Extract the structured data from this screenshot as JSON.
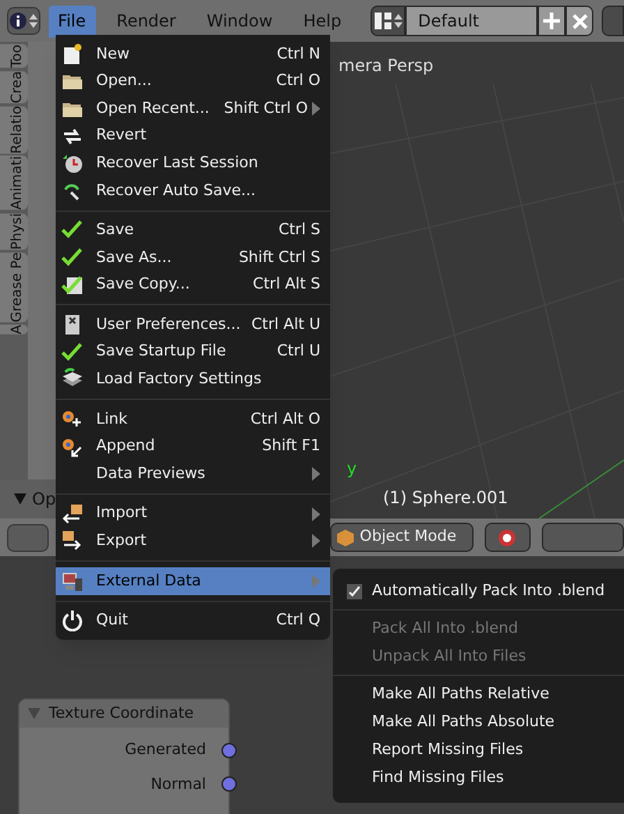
{
  "top_bar": {
    "menus": [
      {
        "label": "File",
        "selected": true
      },
      {
        "label": "Render",
        "selected": false
      },
      {
        "label": "Window",
        "selected": false
      },
      {
        "label": "Help",
        "selected": false
      }
    ],
    "layout": "Default"
  },
  "tool_tabs": [
    {
      "label": "Too"
    },
    {
      "label": "Crea"
    },
    {
      "label": "Relatio"
    },
    {
      "label": "Animati"
    },
    {
      "label": "Physi"
    },
    {
      "label": "Grease Pe"
    },
    {
      "label": "A"
    }
  ],
  "operator_panel": {
    "title": "Op"
  },
  "viewport": {
    "view_label": "mera Persp",
    "axis_label": "y",
    "object_label": "(1) Sphere.001"
  },
  "view_header": {
    "mode": "Object Mode"
  },
  "file_menu": {
    "groups": [
      [
        {
          "label": "New",
          "shortcut": "Ctrl N",
          "submenu": false,
          "selected": false
        },
        {
          "label": "Open...",
          "shortcut": "Ctrl O",
          "submenu": false,
          "selected": false
        },
        {
          "label": "Open Recent...",
          "shortcut": "Shift Ctrl O",
          "submenu": true,
          "selected": false
        },
        {
          "label": "Revert",
          "submenu": false,
          "selected": false
        },
        {
          "label": "Recover Last Session",
          "submenu": false,
          "selected": false
        },
        {
          "label": "Recover Auto Save...",
          "submenu": false,
          "selected": false
        }
      ],
      [
        {
          "label": "Save",
          "shortcut": "Ctrl S",
          "submenu": false,
          "selected": false
        },
        {
          "label": "Save As...",
          "shortcut": "Shift Ctrl S",
          "submenu": false,
          "selected": false
        },
        {
          "label": "Save Copy...",
          "shortcut": "Ctrl Alt S",
          "submenu": false,
          "selected": false
        }
      ],
      [
        {
          "label": "User Preferences...",
          "shortcut": "Ctrl Alt U",
          "submenu": false,
          "selected": false
        },
        {
          "label": "Save Startup File",
          "shortcut": "Ctrl U",
          "submenu": false,
          "selected": false
        },
        {
          "label": "Load Factory Settings",
          "submenu": false,
          "selected": false
        }
      ],
      [
        {
          "label": "Link",
          "shortcut": "Ctrl Alt O",
          "submenu": false,
          "selected": false
        },
        {
          "label": "Append",
          "shortcut": "Shift F1",
          "submenu": false,
          "selected": false
        },
        {
          "label": "Data Previews",
          "submenu": true,
          "selected": false
        }
      ],
      [
        {
          "label": "Import",
          "submenu": true,
          "selected": false
        },
        {
          "label": "Export",
          "submenu": true,
          "selected": false
        }
      ],
      [
        {
          "label": "External Data",
          "submenu": true,
          "selected": true
        }
      ],
      [
        {
          "label": "Quit",
          "shortcut": "Ctrl Q",
          "submenu": false,
          "selected": false
        }
      ]
    ]
  },
  "external_data_menu": {
    "groups": [
      [
        {
          "label": "Automatically Pack Into .blend",
          "kind": "checkbox",
          "checked": true,
          "disabled": false
        }
      ],
      [
        {
          "label": "Pack All Into .blend",
          "kind": "action",
          "disabled": true
        },
        {
          "label": "Unpack All Into Files",
          "kind": "action",
          "disabled": true
        }
      ],
      [
        {
          "label": "Make All Paths Relative",
          "kind": "action",
          "disabled": false
        },
        {
          "label": "Make All Paths Absolute",
          "kind": "action",
          "disabled": false
        },
        {
          "label": "Report Missing Files",
          "kind": "action",
          "disabled": false
        },
        {
          "label": "Find Missing Files",
          "kind": "action",
          "disabled": false
        }
      ]
    ]
  },
  "node": {
    "title": "Texture Coordinate",
    "outputs": [
      "Generated",
      "Normal"
    ]
  }
}
